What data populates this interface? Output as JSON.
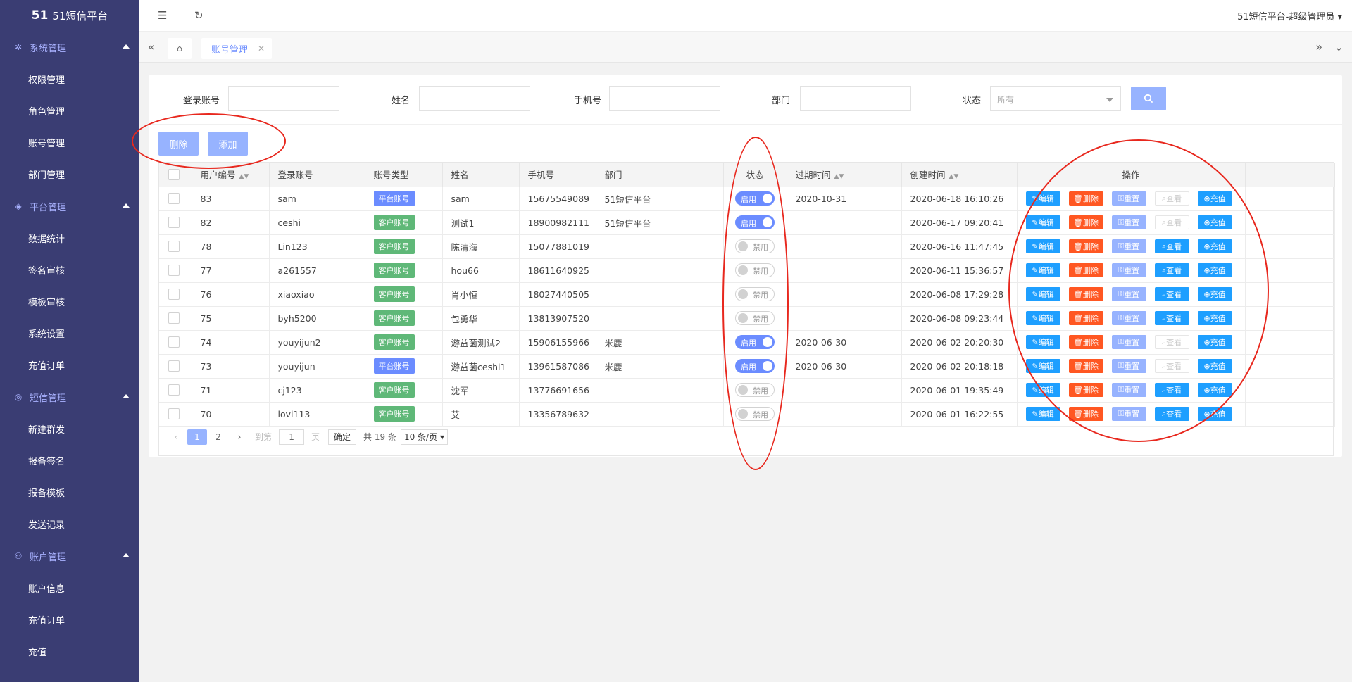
{
  "sidebar": {
    "logo_mark": "51",
    "logo_text": "51短信平台",
    "groups": [
      {
        "label": "系统管理",
        "items": [
          "权限管理",
          "角色管理",
          "账号管理",
          "部门管理"
        ]
      },
      {
        "label": "平台管理",
        "items": [
          "数据统计",
          "签名审核",
          "模板审核",
          "系统设置",
          "充值订单"
        ]
      },
      {
        "label": "短信管理",
        "items": [
          "新建群发",
          "报备签名",
          "报备模板",
          "发送记录"
        ]
      },
      {
        "label": "账户管理",
        "items": [
          "账户信息",
          "充值订单",
          "充值"
        ]
      }
    ]
  },
  "header": {
    "user": "51短信平台-超级管理员"
  },
  "tabs": {
    "active": "账号管理"
  },
  "search": {
    "login_label": "登录账号",
    "name_label": "姓名",
    "phone_label": "手机号",
    "dept_label": "部门",
    "status_label": "状态",
    "status_placeholder": "所有"
  },
  "actions": {
    "delete": "删除",
    "add": "添加"
  },
  "table": {
    "headers": [
      "用户编号",
      "登录账号",
      "账号类型",
      "姓名",
      "手机号",
      "部门",
      "状态",
      "过期时间",
      "创建时间",
      "操作"
    ],
    "op_labels": {
      "edit": "编辑",
      "delete": "删除",
      "reset": "重置",
      "view": "查看",
      "charge": "充值"
    },
    "switch_on": "启用",
    "switch_off": "禁用",
    "rows": [
      {
        "id": "83",
        "login": "sam",
        "type": "平台账号",
        "name": "sam",
        "phone": "15675549089",
        "dept": "51短信平台",
        "status": "on",
        "expire": "2020-10-31",
        "created": "2020-06-18 16:10:26",
        "view_enabled": false
      },
      {
        "id": "82",
        "login": "ceshi",
        "type": "客户账号",
        "name": "测试1",
        "phone": "18900982111",
        "dept": "51短信平台",
        "status": "on",
        "expire": "",
        "created": "2020-06-17 09:20:41",
        "view_enabled": false
      },
      {
        "id": "78",
        "login": "Lin123",
        "type": "客户账号",
        "name": "陈清海",
        "phone": "15077881019",
        "dept": "",
        "status": "off",
        "expire": "",
        "created": "2020-06-16 11:47:45",
        "view_enabled": true
      },
      {
        "id": "77",
        "login": "a261557",
        "type": "客户账号",
        "name": "hou66",
        "phone": "18611640925",
        "dept": "",
        "status": "off",
        "expire": "",
        "created": "2020-06-11 15:36:57",
        "view_enabled": true
      },
      {
        "id": "76",
        "login": "xiaoxiao",
        "type": "客户账号",
        "name": "肖小恒",
        "phone": "18027440505",
        "dept": "",
        "status": "off",
        "expire": "",
        "created": "2020-06-08 17:29:28",
        "view_enabled": true
      },
      {
        "id": "75",
        "login": "byh5200",
        "type": "客户账号",
        "name": "包勇华",
        "phone": "13813907520",
        "dept": "",
        "status": "off",
        "expire": "",
        "created": "2020-06-08 09:23:44",
        "view_enabled": true
      },
      {
        "id": "74",
        "login": "youyijun2",
        "type": "客户账号",
        "name": "游益菌测试2",
        "phone": "15906155966",
        "dept": "米鹿",
        "status": "on",
        "expire": "2020-06-30",
        "created": "2020-06-02 20:20:30",
        "view_enabled": false
      },
      {
        "id": "73",
        "login": "youyijun",
        "type": "平台账号",
        "name": "游益菌ceshi1",
        "phone": "13961587086",
        "dept": "米鹿",
        "status": "on",
        "expire": "2020-06-30",
        "created": "2020-06-02 20:18:18",
        "view_enabled": false
      },
      {
        "id": "71",
        "login": "cj123",
        "type": "客户账号",
        "name": "沈军",
        "phone": "13776691656",
        "dept": "",
        "status": "off",
        "expire": "",
        "created": "2020-06-01 19:35:49",
        "view_enabled": true
      },
      {
        "id": "70",
        "login": "lovi113",
        "type": "客户账号",
        "name": "艾",
        "phone": "13356789632",
        "dept": "",
        "status": "off",
        "expire": "",
        "created": "2020-06-01 16:22:55",
        "view_enabled": true
      }
    ]
  },
  "pagination": {
    "prev": "‹",
    "next": "›",
    "pages": [
      "1",
      "2"
    ],
    "current": "1",
    "goto_label": "到第",
    "goto_value": "1",
    "page_unit": "页",
    "confirm": "确定",
    "total": "共 19 条",
    "per_page": "10 条/页"
  },
  "colors": {
    "sidebar_bg": "#3a3d73",
    "accent": "#6b8cff",
    "platform_badge": "#6b8cff",
    "customer_badge": "#5fb878",
    "danger": "#ff5722",
    "primary": "#1e9fff"
  }
}
